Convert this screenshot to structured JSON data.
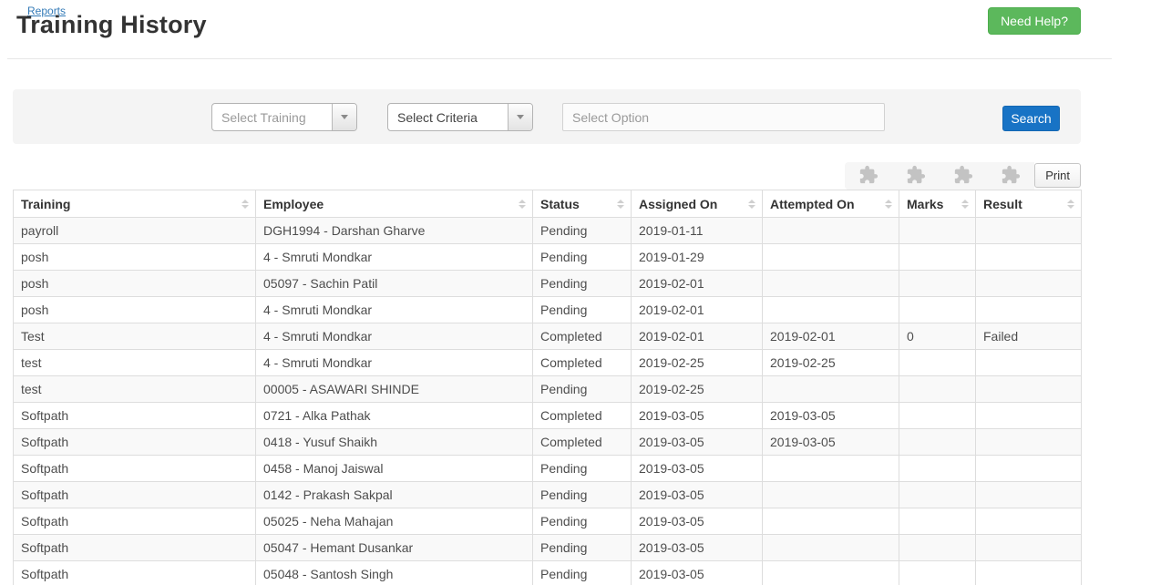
{
  "page": {
    "breadcrumb": "Reports",
    "title": "Training History",
    "help_button_label": "Need Help?"
  },
  "filters": {
    "training_select_value": "Select Training",
    "criteria_select_value": "Select Criteria",
    "option_input_placeholder": "Select Option",
    "search_button_label": "Search"
  },
  "toolbar": {
    "export_buttons": [
      "puzzle-icon",
      "puzzle-icon",
      "puzzle-icon",
      "puzzle-icon"
    ],
    "print_button_label": "Print"
  },
  "table": {
    "columns": [
      "Training",
      "Employee",
      "Status",
      "Assigned On",
      "Attempted On",
      "Marks",
      "Result"
    ],
    "rows": [
      [
        "payroll",
        "DGH1994 - Darshan Gharve",
        "Pending",
        "2019-01-11",
        "",
        "",
        ""
      ],
      [
        "posh",
        "4 - Smruti Mondkar",
        "Pending",
        "2019-01-29",
        "",
        "",
        ""
      ],
      [
        "posh",
        "05097 - Sachin Patil",
        "Pending",
        "2019-02-01",
        "",
        "",
        ""
      ],
      [
        "posh",
        "4 - Smruti Mondkar",
        "Pending",
        "2019-02-01",
        "",
        "",
        ""
      ],
      [
        "Test",
        "4 - Smruti Mondkar",
        "Completed",
        "2019-02-01",
        "2019-02-01",
        "0",
        "Failed"
      ],
      [
        "test",
        "4 - Smruti Mondkar",
        "Completed",
        "2019-02-25",
        "2019-02-25",
        "",
        ""
      ],
      [
        "test",
        "00005 - ASAWARI SHINDE",
        "Pending",
        "2019-02-25",
        "",
        "",
        ""
      ],
      [
        "Softpath",
        "0721 - Alka Pathak",
        "Completed",
        "2019-03-05",
        "2019-03-05",
        "",
        ""
      ],
      [
        "Softpath",
        "0418 - Yusuf Shaikh",
        "Completed",
        "2019-03-05",
        "2019-03-05",
        "",
        ""
      ],
      [
        "Softpath",
        "0458 - Manoj Jaiswal",
        "Pending",
        "2019-03-05",
        "",
        "",
        ""
      ],
      [
        "Softpath",
        "0142 - Prakash Sakpal",
        "Pending",
        "2019-03-05",
        "",
        "",
        ""
      ],
      [
        "Softpath",
        "05025 - Neha Mahajan",
        "Pending",
        "2019-03-05",
        "",
        "",
        ""
      ],
      [
        "Softpath",
        "05047 - Hemant Dusankar",
        "Pending",
        "2019-03-05",
        "",
        "",
        ""
      ],
      [
        "Softpath",
        "05048 - Santosh Singh",
        "Pending",
        "2019-03-05",
        "",
        "",
        ""
      ]
    ]
  },
  "colors": {
    "link_blue": "#337ab7",
    "search_blue": "#1873c5",
    "help_green": "#5cb85c",
    "panel_gray": "#f4f4f4",
    "border_gray": "#dddddd",
    "stripe_gray": "#f9f9f9"
  }
}
